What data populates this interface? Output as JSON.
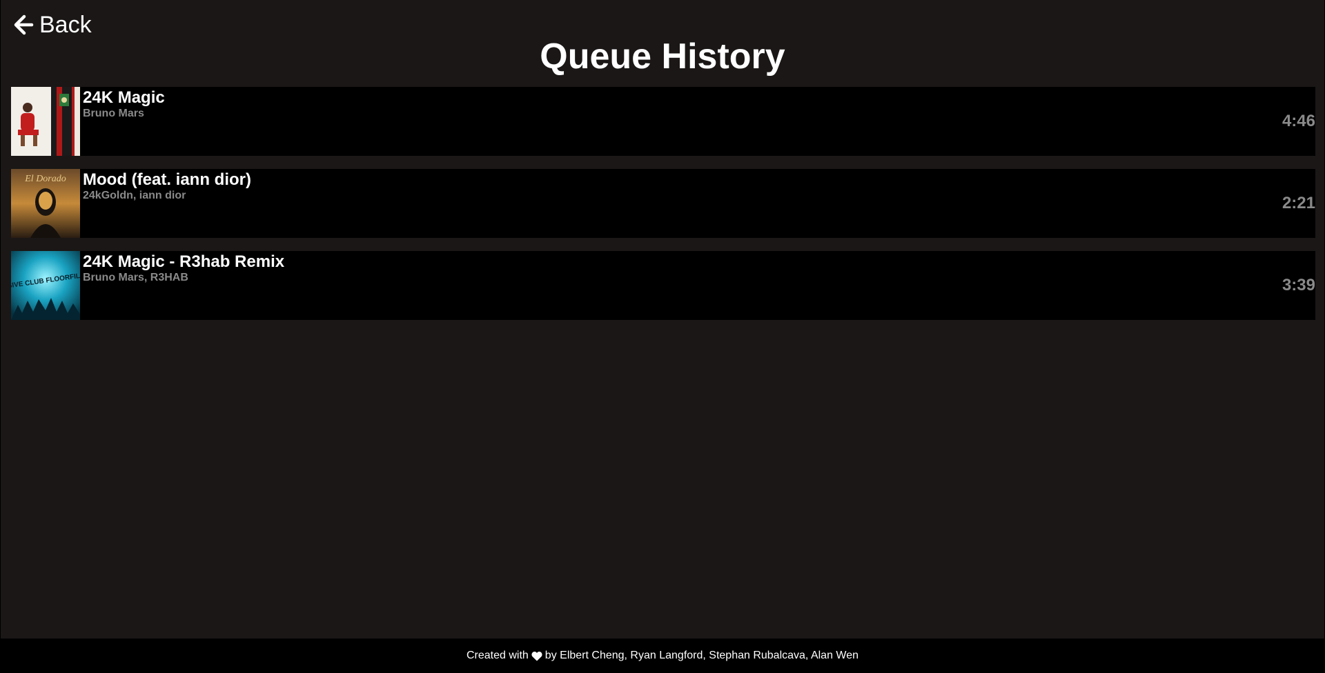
{
  "nav": {
    "back_label": "Back",
    "back_icon": "arrow-left-icon"
  },
  "page": {
    "title": "Queue History"
  },
  "queue": [
    {
      "title": "24K Magic",
      "artist": "Bruno Mars",
      "duration": "4:46",
      "art_icon": "album-art-24k-magic"
    },
    {
      "title": "Mood (feat. iann dior)",
      "artist": "24kGoldn, iann dior",
      "duration": "2:21",
      "art_icon": "album-art-el-dorado",
      "art_text": "El Dorado"
    },
    {
      "title": "24K Magic - R3hab Remix",
      "artist": "Bruno Mars, R3HAB",
      "duration": "3:39",
      "art_icon": "album-art-massive-club-floorfillers",
      "art_text": "MASSIVE CLUB FLOORFILLERS"
    }
  ],
  "footer": {
    "prefix": "Created with",
    "icon": "heart-icon",
    "suffix": "by Elbert Cheng, Ryan Langford, Stephan Rubalcava, Alan Wen"
  },
  "colors": {
    "background": "#1a1716",
    "row_background": "#000000",
    "secondary_text": "#8a8a8a"
  }
}
